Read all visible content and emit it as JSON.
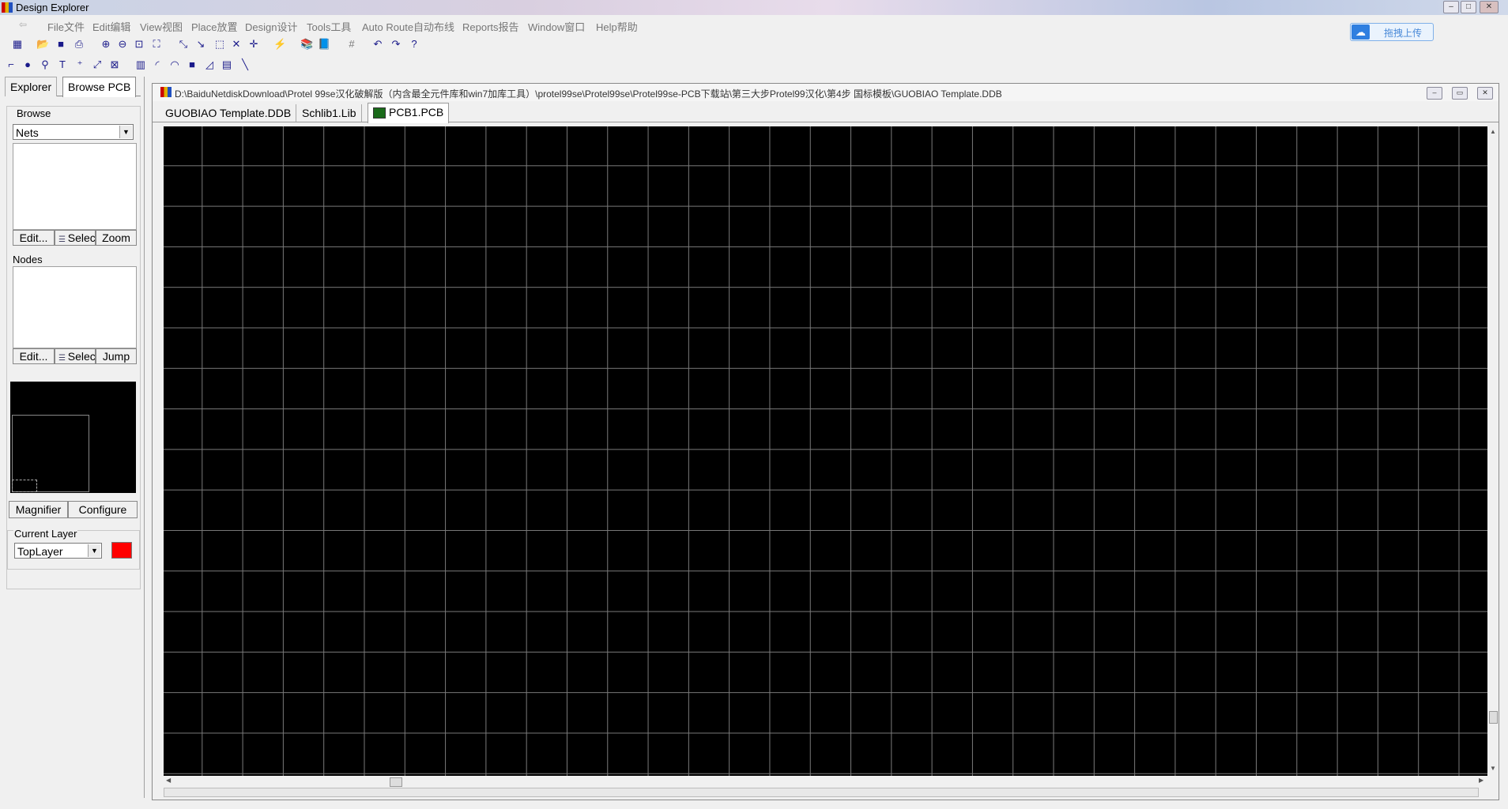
{
  "window": {
    "title": "Design Explorer",
    "minimize": "–",
    "maximize": "□",
    "close": "✕"
  },
  "menu": [
    "File文件",
    "Edit编辑",
    "View视图",
    "Place放置",
    "Design设计",
    "Tools工具",
    "Auto Route自动布线",
    "Reports报告",
    "Window窗口",
    "Help帮助"
  ],
  "baidu": {
    "label": "拖拽上传"
  },
  "panel": {
    "tabs": [
      "Explorer",
      "Browse PCB"
    ],
    "browse_label": "Browse",
    "browse_value": "Nets",
    "buttons1": [
      "Edit...",
      "Selec",
      "Zoom"
    ],
    "nodes_label": "Nodes",
    "buttons2": [
      "Edit...",
      "Selec",
      "Jump"
    ],
    "magnifier": "Magnifier",
    "configure": "Configure",
    "current_layer_label": "Current Layer",
    "layer_value": "TopLayer",
    "layer_color": "#ff0000"
  },
  "document": {
    "path": "D:\\BaiduNetdiskDownload\\Protel 99se汉化破解版（内含最全元件库和win7加库工具）\\protel99se\\Protel99se\\Protel99se-PCB下载站\\第三大步Protel99汉化\\第4步 国标模板\\GUOBIAO Template.DDB",
    "tabs": [
      "GUOBIAO Template.DDB",
      "Schlib1.Lib",
      "PCB1.PCB"
    ],
    "active_tab": "PCB1.PCB"
  }
}
